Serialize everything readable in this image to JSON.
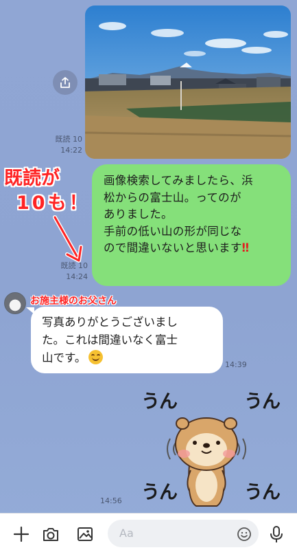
{
  "messages": {
    "photo": {
      "read_receipt": "既読 10",
      "time": "14:22"
    },
    "outgoing_text": {
      "lines": [
        "画像検索してみましたら、浜",
        "松からの富士山。ってのが",
        "ありました。",
        "手前の低い山の形が同じな",
        "ので間違いないと思いま"
      ],
      "last_line_tail": "す",
      "exclamation": "‼",
      "read_receipt": "既読 10",
      "time": "14:24"
    },
    "incoming": {
      "sender": "お施主様のお父さん",
      "lines": [
        "写真ありがとうございまし",
        "た。これは間違いなく富士",
        "山です。"
      ],
      "emoji": "smiling-face",
      "time": "14:39"
    },
    "sticker": {
      "words": [
        "うん",
        "うん",
        "うん",
        "うん"
      ],
      "time": "14:56"
    }
  },
  "annotation": {
    "line1": "既読が",
    "line2": "10も！",
    "color": "#ff2323"
  },
  "input_bar": {
    "placeholder": "Aa",
    "icons": [
      "plus-icon",
      "camera-icon",
      "image-icon",
      "emoji-icon",
      "microphone-icon"
    ]
  },
  "colors": {
    "background": "#8fa6d3",
    "outgoing_bubble": "#85e07a",
    "incoming_bubble": "#ffffff",
    "annotation_red": "#ff2323"
  }
}
